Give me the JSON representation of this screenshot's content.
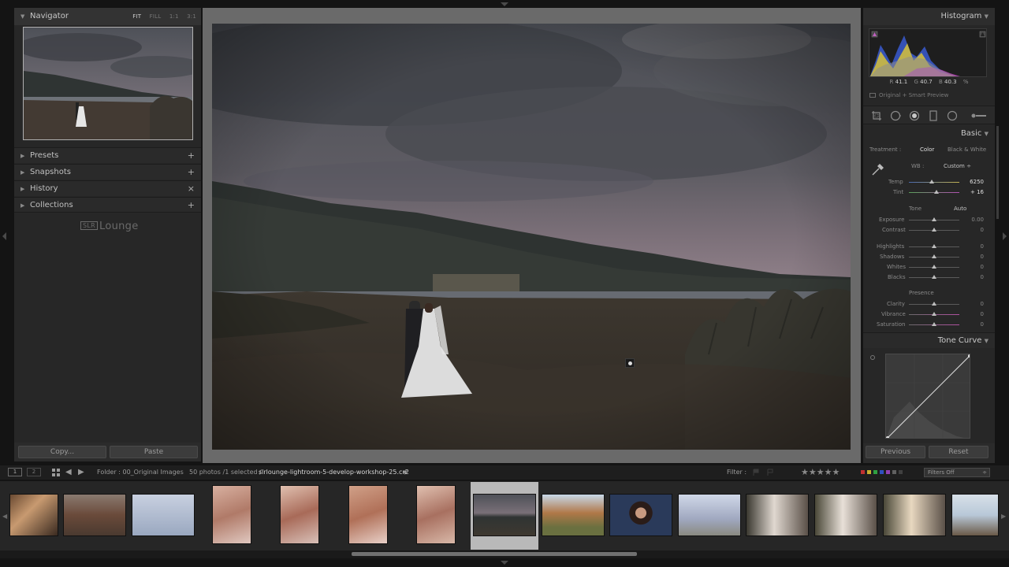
{
  "navigator": {
    "title": "Navigator",
    "zoom_options": [
      "FIT",
      "FILL",
      "1:1",
      "3:1"
    ],
    "active_zoom": "FIT"
  },
  "left_sections": [
    {
      "label": "Presets",
      "action": "+"
    },
    {
      "label": "Snapshots",
      "action": "+"
    },
    {
      "label": "History",
      "action": "×"
    },
    {
      "label": "Collections",
      "action": "+"
    }
  ],
  "logo": {
    "box": "SLR",
    "text": "Lounge"
  },
  "left_buttons": {
    "copy": "Copy...",
    "paste": "Paste"
  },
  "histogram": {
    "title": "Histogram",
    "r_label": "R",
    "r_value": "41.1",
    "g_label": "G",
    "g_value": "40.7",
    "b_label": "B",
    "b_value": "40.3",
    "unit": "%",
    "preview_status": "Original + Smart Preview"
  },
  "tools": [
    "crop-overlay-icon",
    "spot-removal-icon",
    "red-eye-icon",
    "graduated-filter-icon",
    "radial-filter-icon",
    "adjustment-brush-icon"
  ],
  "basic": {
    "title": "Basic",
    "treatment_label": "Treatment :",
    "treatment_color": "Color",
    "treatment_bw": "Black & White",
    "wb_label": "WB :",
    "wb_value": "Custom",
    "temp_label": "Temp",
    "temp_value": "6250",
    "tint_label": "Tint",
    "tint_value": "+ 16",
    "tone_label": "Tone",
    "auto_label": "Auto",
    "exposure_label": "Exposure",
    "exposure_value": "0.00",
    "contrast_label": "Contrast",
    "contrast_value": "0",
    "highlights_label": "Highlights",
    "highlights_value": "0",
    "shadows_label": "Shadows",
    "shadows_value": "0",
    "whites_label": "Whites",
    "whites_value": "0",
    "blacks_label": "Blacks",
    "blacks_value": "0",
    "presence_label": "Presence",
    "clarity_label": "Clarity",
    "clarity_value": "0",
    "vibrance_label": "Vibrance",
    "vibrance_value": "0",
    "saturation_label": "Saturation",
    "saturation_value": "0"
  },
  "tone_curve": {
    "title": "Tone Curve"
  },
  "right_buttons": {
    "previous": "Previous",
    "reset": "Reset"
  },
  "film_bar": {
    "monitor1": "1",
    "monitor2": "2",
    "folder": "Folder : 00_Original Images",
    "count": "50 photos /1 selected /",
    "filename": "slrlounge-lightroom-5-develop-workshop-25.cr2",
    "filter_label": "Filter :",
    "stars": "★★★★★",
    "filters_off": "Filters Off"
  },
  "colors": {
    "panel_bg": "#272727",
    "background": "#141414",
    "center_bg": "#6a6a6a",
    "selection": "#b9b9b9"
  }
}
